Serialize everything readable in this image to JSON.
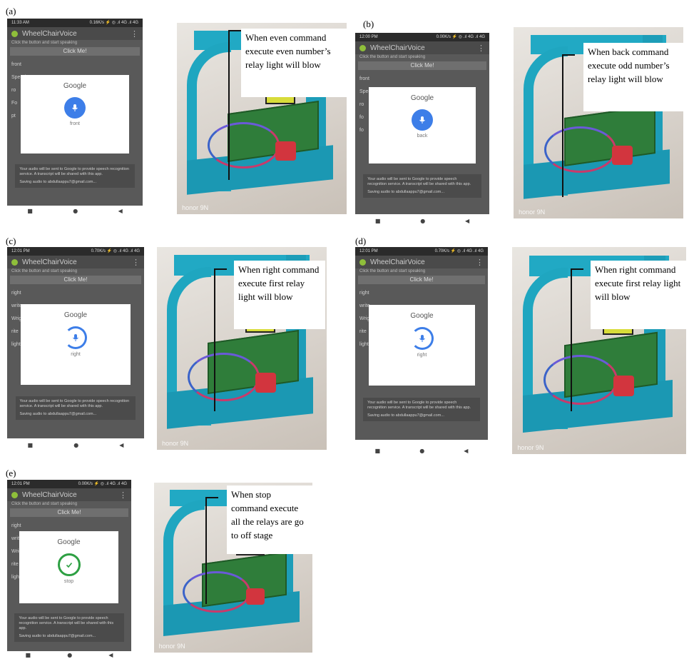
{
  "phone": {
    "app_title": "WheelChairVoice",
    "subtitle": "Click the button and start speaking",
    "button_label": "Click Me!",
    "dialog_title": "Google",
    "notice": "Your audio will be sent to Google to provide speech recognition service. A transcript will be shared with this app.",
    "saving": "Saving audio to abdullaappu7@gmail.com...",
    "nav": [
      "■",
      "●",
      "◀"
    ]
  },
  "panels": [
    {
      "label": "(a)",
      "status_time": "11:33 AM",
      "status_right": "0.16K/s ⚡ ◎ .ıl 4G .ıl 4G",
      "words": [
        "front",
        "Speed",
        "ro",
        "Fo",
        "pt"
      ],
      "heard": "front",
      "annotation": "When even command execute even number’s relay light will blow",
      "watermark": "honor 9N",
      "mic_style": "filled"
    },
    {
      "label": "(b)",
      "status_time": "12:00 PM",
      "status_right": "0.00K/s ⚡ ◎ .ıl 4G .ıl 4G",
      "words": [
        "front",
        "Speed",
        "ro",
        "fo",
        "fo"
      ],
      "heard": "back",
      "annotation": "When back command execute odd number’s relay light will blow",
      "watermark": "honor 9N",
      "mic_style": "filled"
    },
    {
      "label": "(c)",
      "status_time": "12:01 PM",
      "status_right": "0.70K/s ⚡ ◎ .ıl 4G .ıl 4G",
      "words": [
        "right",
        "write",
        "Wright",
        "rite",
        "light"
      ],
      "heard": "right",
      "annotation": "When right command execute first relay light will blow",
      "watermark": "honor 9N",
      "mic_style": "ring"
    },
    {
      "label": "(d)",
      "status_time": "12:01 PM",
      "status_right": "0.70K/s ⚡ ◎ .ıl 4G .ıl 4G",
      "words": [
        "right",
        "write",
        "Wright",
        "rite",
        "light"
      ],
      "heard": "right",
      "annotation": "When right command execute first relay light will blow",
      "watermark": "honor 9N",
      "mic_style": "ring"
    },
    {
      "label": "(e)",
      "status_time": "12:01 PM",
      "status_right": "0.00K/s ⚡ ◎ .ıl 4G .ıl 4G",
      "words": [
        "right",
        "write",
        "Wright",
        "rite",
        "light"
      ],
      "heard": "stop",
      "annotation": "When stop command execute all the relays are go to off stage",
      "watermark": "honor 9N",
      "mic_style": "done"
    }
  ]
}
